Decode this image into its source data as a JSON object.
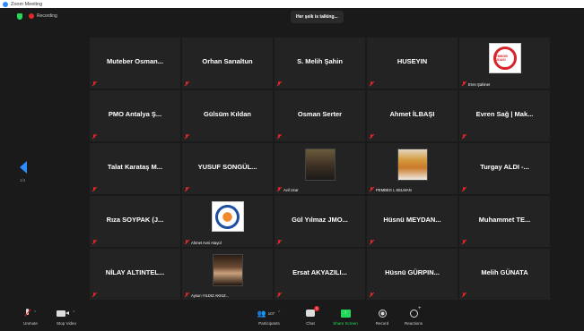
{
  "window": {
    "title": "Zoom Meeting"
  },
  "topbar": {
    "recording_label": "Recording",
    "talking_text": "Her şeik is talking..."
  },
  "navigation": {
    "page_indicator": "1/4"
  },
  "tiles": [
    {
      "type": "name",
      "name": "Muteber Osman..."
    },
    {
      "type": "name",
      "name": "Orhan Sarıaltun"
    },
    {
      "type": "name",
      "name": "S. Melih Şahin"
    },
    {
      "type": "name",
      "name": "HUSEYIN"
    },
    {
      "type": "logo-red",
      "caption": "Eren Şahiner",
      "logo_text": "TMMOB ODASI"
    },
    {
      "type": "name",
      "name": "PMO Antalya Ş..."
    },
    {
      "type": "name",
      "name": "Gülsüm Kıldan"
    },
    {
      "type": "name",
      "name": "Osman Serter"
    },
    {
      "type": "name",
      "name": "Ahmet İLBAŞI"
    },
    {
      "type": "name",
      "name": "Evren Sağ | Mak..."
    },
    {
      "type": "name",
      "name": "Talat Karataş M..."
    },
    {
      "type": "name",
      "name": "YUSUF SONGÜL..."
    },
    {
      "type": "photo",
      "variant": "",
      "caption": "Avil Ucar"
    },
    {
      "type": "photo",
      "variant": "blond",
      "caption": "PEMBEG L SELMAN"
    },
    {
      "type": "name",
      "name": "Turgay ALDI -..."
    },
    {
      "type": "name",
      "name": "Rıza SOYPAK (J..."
    },
    {
      "type": "logo-blue",
      "caption": "Ahmet Avni Atayol"
    },
    {
      "type": "name",
      "name": "Gül Yılmaz JMO..."
    },
    {
      "type": "name",
      "name": "Hüsnü MEYDAN..."
    },
    {
      "type": "name",
      "name": "Muhammet TE..."
    },
    {
      "type": "name",
      "name": "NİLAY ALTINTEL..."
    },
    {
      "type": "photo",
      "variant": "dark",
      "caption": "Aysun YILDIZ AKKIZ..."
    },
    {
      "type": "name",
      "name": "Ersat AKYAZILI..."
    },
    {
      "type": "name",
      "name": "Hüsnü GÜRPIN..."
    },
    {
      "type": "name",
      "name": "Melih GÜNATA"
    }
  ],
  "toolbar": {
    "unmute": "Unmute",
    "stop_video": "Stop Video",
    "participants": "Participants",
    "participants_count": "107",
    "chat": "Chat",
    "chat_badge": "2",
    "share_screen": "Share Screen",
    "record": "Record",
    "reactions": "Reactions"
  },
  "colors": {
    "accent": "#2d8cff",
    "green": "#23d959",
    "red": "#e02828",
    "tile_bg": "#232323",
    "window_bg": "#1a1a1a"
  }
}
